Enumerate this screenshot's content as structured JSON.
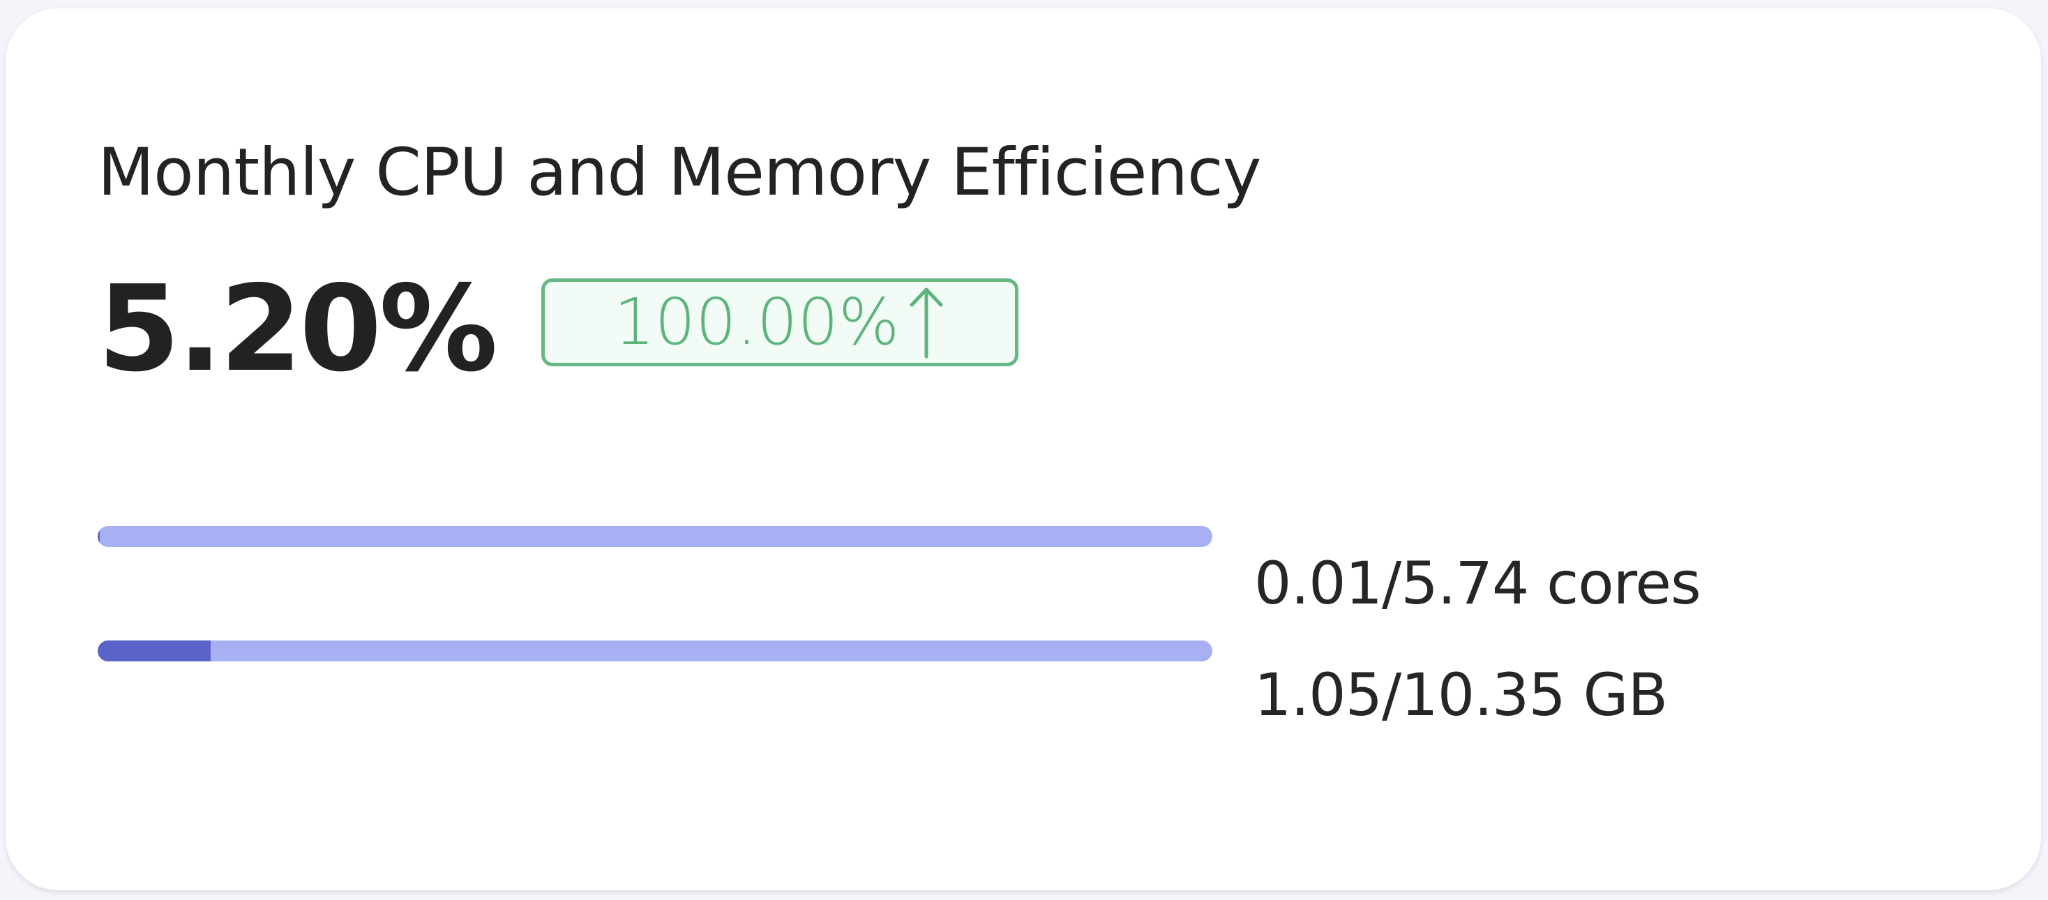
{
  "card": {
    "title": "Monthly CPU and Memory Efficiency",
    "efficiency_value": "5.20%",
    "trend": {
      "value": "100.00%",
      "direction_icon": "arrow-up-icon",
      "color": "#5cb47b"
    }
  },
  "cpu": {
    "usage_label": "0.01/5.74 cores",
    "used": 0.01,
    "total": 5.74,
    "bar_color": "#a8b0f4",
    "fill_color": "#5a64c8"
  },
  "memory": {
    "usage_label": "1.05/10.35 GB",
    "used": 1.05,
    "total": 10.35,
    "bar_color": "#a8b0f4",
    "fill_color": "#5a64c8"
  }
}
